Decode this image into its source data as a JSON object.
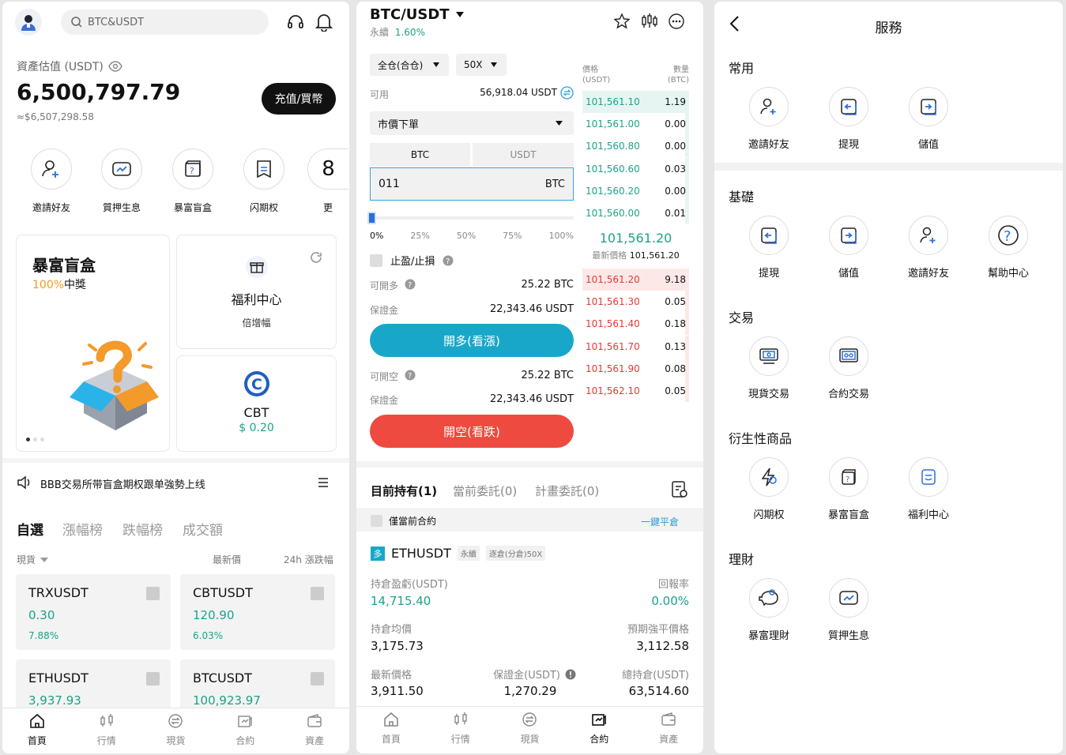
{
  "home": {
    "search_placeholder": "BTC&USDT",
    "asset_label": "資產估值 (USDT)",
    "asset_value": "6,500,797.79",
    "asset_fiat": "≈$6,507,298.58",
    "deposit_button": "充值/買幣",
    "quick": [
      "邀請好友",
      "質押生息",
      "暴富盲盒",
      "闪期权",
      "更"
    ],
    "promo_title": "暴富盲盒",
    "promo_pct": "100%",
    "promo_win": "中獎",
    "welfare_title": "福利中心",
    "welfare_sub": "倍增幅",
    "coin_name": "CBT",
    "coin_price": "$ 0.20",
    "notice": "BBB交易所带盲盒期权跟单強勢上线",
    "tabs": [
      "自選",
      "漲幅榜",
      "跌幅榜",
      "成交額"
    ],
    "list_head": [
      "現貨",
      "最新價",
      "24h 漲跌幅"
    ],
    "tickers": [
      {
        "name": "TRXUSDT",
        "price": "0.30",
        "change": "7.88%"
      },
      {
        "name": "CBTUSDT",
        "price": "120.90",
        "change": "6.03%"
      },
      {
        "name": "ETHUSDT",
        "price": "3,937.93",
        "change": ""
      },
      {
        "name": "BTCUSDT",
        "price": "100,923.97",
        "change": ""
      }
    ],
    "nav": [
      "首頁",
      "行情",
      "現貨",
      "合約",
      "資產"
    ]
  },
  "trade": {
    "pair": "BTC/USDT",
    "kind": "永續",
    "change": "1.60%",
    "margin_mode": "全仓(合仓)",
    "leverage": "50X",
    "available_label": "可用",
    "available_value": "56,918.04 USDT",
    "order_type": "市價下單",
    "unit_tabs": [
      "BTC",
      "USDT"
    ],
    "amount": "011",
    "amount_unit": "BTC",
    "pcts": [
      "0%",
      "25%",
      "50%",
      "75%",
      "100%"
    ],
    "tpsl": "止盈/止損",
    "long_label": "可開多",
    "long_value": "25.22 BTC",
    "margin_label": "保證金",
    "margin_value": "22,343.46 USDT",
    "long_button": "開多(看漲)",
    "short_label": "可開空",
    "short_value": "25.22 BTC",
    "short_button": "開空(看跌)",
    "ob_price_head": "價格\n(USDT)",
    "ob_qty_head": "數量\n(BTC)",
    "bids": [
      {
        "p": "101,561.10",
        "q": "1.19",
        "d": 1.0
      },
      {
        "p": "101,561.00",
        "q": "0.00",
        "d": 0.04
      },
      {
        "p": "101,560.80",
        "q": "0.00",
        "d": 0.04
      },
      {
        "p": "101,560.60",
        "q": "0.03",
        "d": 0.04
      },
      {
        "p": "101,560.20",
        "q": "0.00",
        "d": 0.04
      },
      {
        "p": "101,560.00",
        "q": "0.01",
        "d": 0.04
      }
    ],
    "mid_price": "101,561.20",
    "last_label": "最新價格",
    "last_value": "101,561.20",
    "asks": [
      {
        "p": "101,561.20",
        "q": "9.18",
        "d": 1.0
      },
      {
        "p": "101,561.30",
        "q": "0.05",
        "d": 0.04
      },
      {
        "p": "101,561.40",
        "q": "0.18",
        "d": 0.04
      },
      {
        "p": "101,561.70",
        "q": "0.13",
        "d": 0.04
      },
      {
        "p": "101,561.90",
        "q": "0.08",
        "d": 0.04
      },
      {
        "p": "101,562.10",
        "q": "0.05",
        "d": 0.04
      }
    ],
    "pos_tabs": [
      "目前持有(1)",
      "當前委託(0)",
      "計畫委託(0)"
    ],
    "only_current": "僅當前合約",
    "close_all": "一鍵平倉",
    "pos_side": "多",
    "pos_symbol": "ETHUSDT",
    "pos_kind": "永續",
    "pos_mode": "逐倉(分倉)50X",
    "pnl_label": "持倉盈虧(USDT)",
    "pnl_value": "14,715.40",
    "roe_label": "回報率",
    "roe_value": "0.00%",
    "avg_label": "持倉均價",
    "avg_value": "3,175.73",
    "liq_label": "預期強平價格",
    "liq_value": "3,112.58",
    "last2_label": "最新價格",
    "last2_value": "3,911.50",
    "mg_label": "保證金(USDT)",
    "mg_value": "1,270.29",
    "total_label": "總持倉(USDT)",
    "total_value": "63,514.60",
    "nav": [
      "首頁",
      "行情",
      "現貨",
      "合約",
      "資產"
    ]
  },
  "services": {
    "title": "服務",
    "sections": [
      {
        "name": "常用",
        "items": [
          "邀請好友",
          "提現",
          "儲值"
        ]
      },
      {
        "name": "基礎",
        "items": [
          "提現",
          "儲值",
          "邀請好友",
          "幫助中心"
        ]
      },
      {
        "name": "交易",
        "items": [
          "現貨交易",
          "合約交易"
        ]
      },
      {
        "name": "衍生性商品",
        "items": [
          "闪期权",
          "暴富盲盒",
          "福利中心"
        ]
      },
      {
        "name": "理財",
        "items": [
          "暴富理財",
          "質押生息"
        ]
      }
    ]
  },
  "colors": {
    "green": "#1aa38a",
    "red": "#e53935",
    "long": "#19a7c9",
    "short": "#ee4a3f"
  }
}
